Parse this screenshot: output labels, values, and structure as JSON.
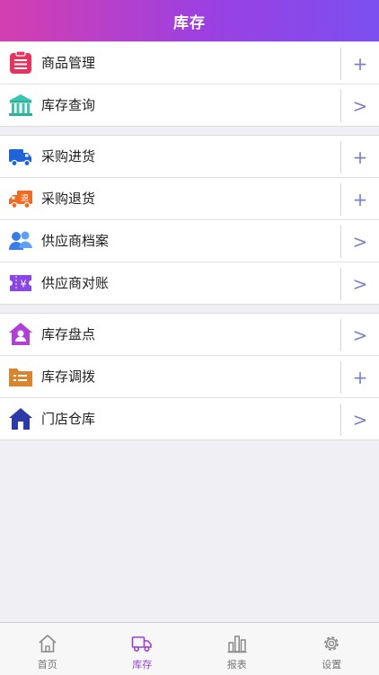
{
  "header": {
    "title": "库存"
  },
  "groups": [
    {
      "items": [
        {
          "label": "商品管理",
          "icon": "clipboard-list-icon",
          "action": "+"
        },
        {
          "label": "库存查询",
          "icon": "warehouse-building-icon",
          "action": ">"
        }
      ]
    },
    {
      "items": [
        {
          "label": "采购进货",
          "icon": "delivery-truck-icon",
          "action": "+"
        },
        {
          "label": "采购退货",
          "icon": "return-truck-icon",
          "action": "+"
        },
        {
          "label": "供应商档案",
          "icon": "supplier-users-icon",
          "action": ">"
        },
        {
          "label": "供应商对账",
          "icon": "yen-ticket-icon",
          "action": ">"
        }
      ]
    },
    {
      "items": [
        {
          "label": "库存盘点",
          "icon": "house-person-icon",
          "action": ">"
        },
        {
          "label": "库存调拨",
          "icon": "transfer-folder-icon",
          "action": "+"
        },
        {
          "label": "门店仓库",
          "icon": "store-house-icon",
          "action": ">"
        }
      ]
    }
  ],
  "return_badge": "退",
  "yen_symbol": "¥",
  "tabbar": {
    "tabs": [
      {
        "label": "首页",
        "icon": "home-icon",
        "active": false
      },
      {
        "label": "库存",
        "icon": "truck-icon",
        "active": true
      },
      {
        "label": "报表",
        "icon": "bar-chart-icon",
        "active": false
      },
      {
        "label": "设置",
        "icon": "gear-icon",
        "active": false
      }
    ]
  },
  "colors": {
    "header_start": "#d43fb0",
    "header_end": "#7c4ff0",
    "action": "#7f7fc8",
    "active_tab": "#9a3fd6"
  }
}
